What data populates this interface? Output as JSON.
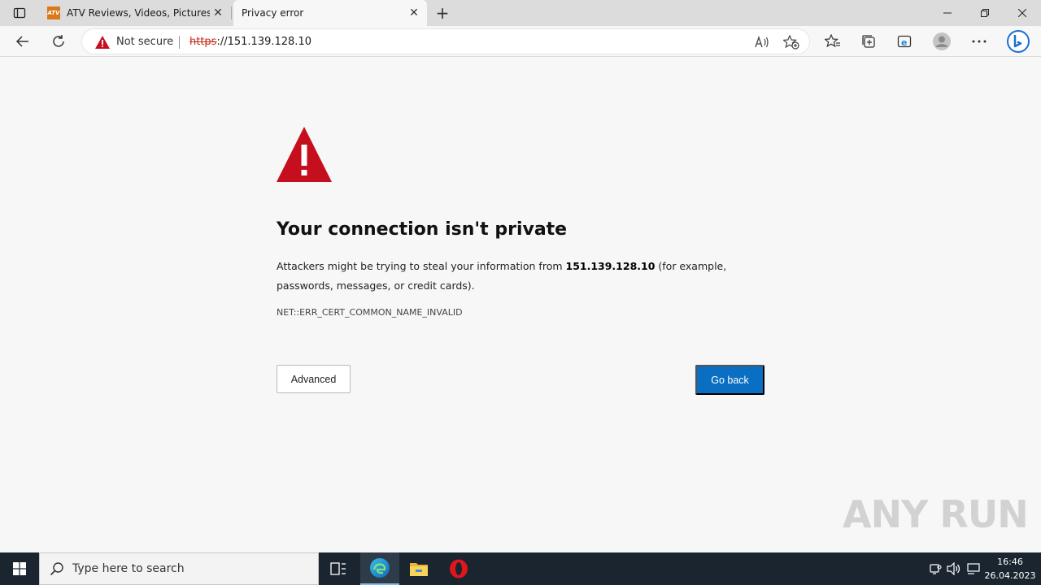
{
  "browser": {
    "tabs": [
      {
        "title": "ATV Reviews, Videos, Pictures, an",
        "favicon_text": "ATV"
      },
      {
        "title": "Privacy error"
      }
    ],
    "address": {
      "security_label": "Not secure",
      "url_scheme": "https",
      "url_rest": "://151.139.128.10"
    }
  },
  "page": {
    "heading": "Your connection isn't private",
    "desc_before": "Attackers might be trying to steal your information from ",
    "desc_host": "151.139.128.10",
    "desc_after": " (for example, passwords, messages, or credit cards).",
    "error_code": "NET::ERR_CERT_COMMON_NAME_INVALID",
    "advanced_label": "Advanced",
    "go_back_label": "Go back",
    "accent_color": "#0a6fc2",
    "warning_color": "#c50f1f"
  },
  "watermark": "ANY RUN",
  "taskbar": {
    "search_placeholder": "Type here to search",
    "time": "16:46",
    "date": "26.04.2023"
  }
}
